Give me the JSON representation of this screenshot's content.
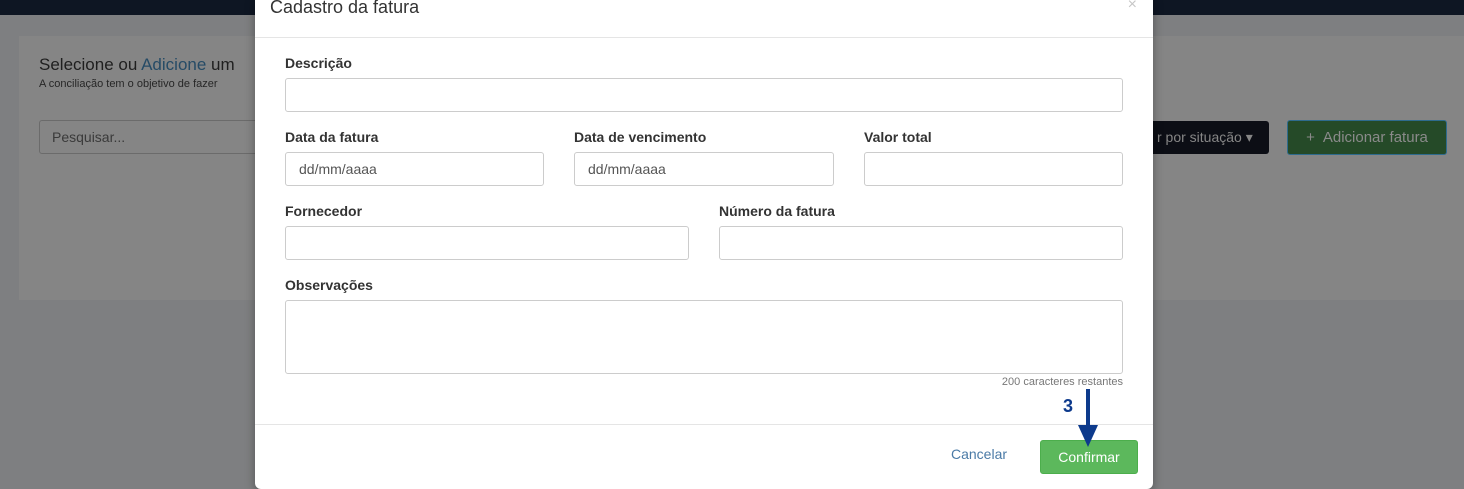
{
  "background": {
    "title_prefix": "Selecione ou ",
    "title_link": "Adicione",
    "title_suffix": " um",
    "subtitle": "A conciliação tem o objetivo de fazer",
    "search_placeholder": "Pesquisar...",
    "filter_label": "r por situação ▾",
    "add_button_label": "Adicionar fatura",
    "add_button_icon": "+"
  },
  "modal": {
    "title": "Cadastro da fatura",
    "close_glyph": "×",
    "fields": {
      "descricao": {
        "label": "Descrição",
        "value": ""
      },
      "data_fatura": {
        "label": "Data da fatura",
        "placeholder": "dd/mm/aaaa"
      },
      "data_vencimento": {
        "label": "Data de vencimento",
        "placeholder": "dd/mm/aaaa"
      },
      "valor_total": {
        "label": "Valor total",
        "value": ""
      },
      "fornecedor": {
        "label": "Fornecedor",
        "value": ""
      },
      "numero_fatura": {
        "label": "Número da fatura",
        "value": ""
      },
      "observacoes": {
        "label": "Observações",
        "value": ""
      }
    },
    "char_counter": "200 caracteres restantes",
    "cancel_label": "Cancelar",
    "confirm_label": "Confirmar"
  },
  "annotation": {
    "step_number": "3",
    "color": "#0d3a8c"
  }
}
